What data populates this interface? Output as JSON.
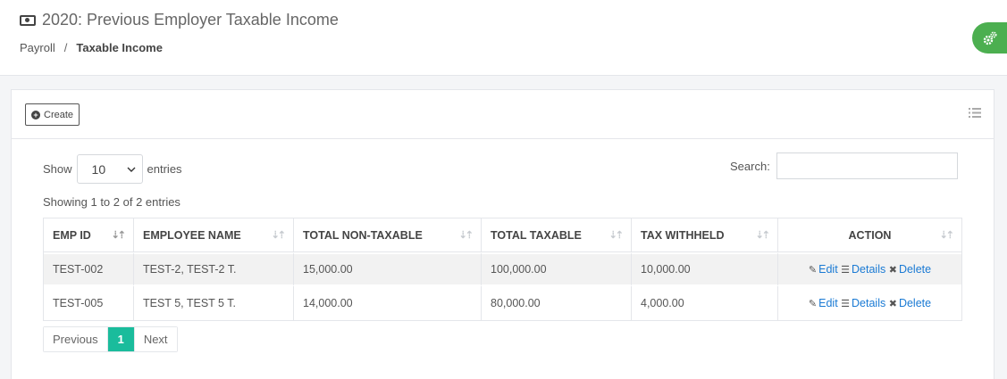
{
  "header": {
    "title": "2020: Previous Employer Taxable Income",
    "breadcrumb": [
      "Payroll",
      "Taxable Income"
    ],
    "breadcrumb_sep": "/"
  },
  "toolbar": {
    "create_label": "Create"
  },
  "table_controls": {
    "show_label": "Show",
    "entries_label": "entries",
    "length_value": "10",
    "search_label": "Search:",
    "search_value": "",
    "info": "Showing 1 to 2 of 2 entries"
  },
  "table": {
    "columns": [
      "EMP ID",
      "EMPLOYEE NAME",
      "TOTAL NON-TAXABLE",
      "TOTAL TAXABLE",
      "TAX WITHHELD",
      "ACTION"
    ],
    "rows": [
      {
        "emp_id": "TEST-002",
        "name": "TEST-2, TEST-2 T.",
        "non_taxable": "15,000.00",
        "taxable": "100,000.00",
        "withheld": "10,000.00"
      },
      {
        "emp_id": "TEST-005",
        "name": "TEST 5, TEST 5 T.",
        "non_taxable": "14,000.00",
        "taxable": "80,000.00",
        "withheld": "4,000.00"
      }
    ],
    "actions": {
      "edit": "Edit",
      "details": "Details",
      "delete": "Delete"
    }
  },
  "pagination": {
    "previous": "Previous",
    "current": "1",
    "next": "Next"
  },
  "colors": {
    "accent": "#1abc9c",
    "fab": "#4caf50",
    "link": "#1a7ad4"
  }
}
